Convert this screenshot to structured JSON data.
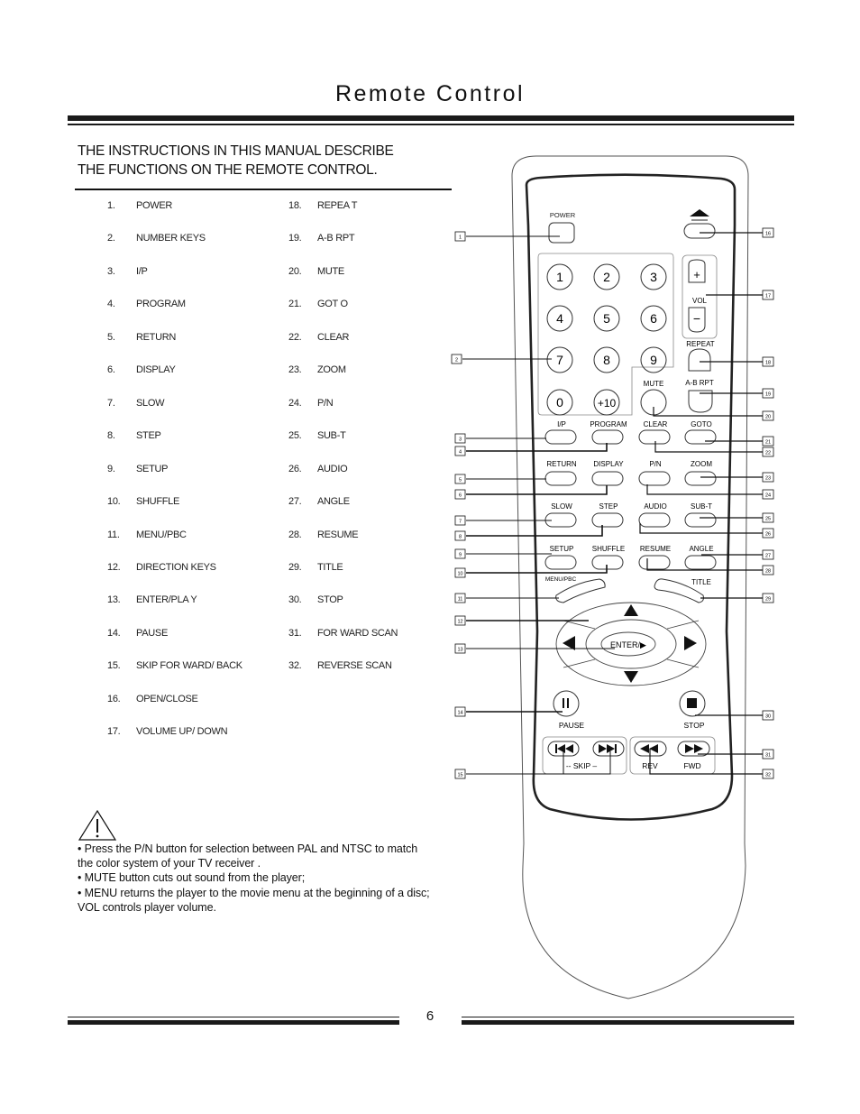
{
  "page": {
    "title": "Remote Control",
    "intro_line1": "THE INSTRUCTIONS IN THIS MANUAL DESCRIBE",
    "intro_line2": "THE FUNCTIONS ON  THE REMOTE CONTROL.",
    "page_number": "6"
  },
  "functions_left": [
    {
      "num": "1.",
      "label": "POWER"
    },
    {
      "num": "2.",
      "label": "NUMBER KEYS"
    },
    {
      "num": "3.",
      "label": "I/P"
    },
    {
      "num": "4.",
      "label": "PROGRAM"
    },
    {
      "num": "5.",
      "label": "RETURN"
    },
    {
      "num": "6.",
      "label": "DISPLAY"
    },
    {
      "num": "7.",
      "label": "SLOW"
    },
    {
      "num": "8.",
      "label": "STEP"
    },
    {
      "num": "9.",
      "label": "SETUP"
    },
    {
      "num": "10.",
      "label": "SHUFFLE"
    },
    {
      "num": "11.",
      "label": "MENU/PBC"
    },
    {
      "num": "12.",
      "label": "DIRECTION KEYS"
    },
    {
      "num": "13.",
      "label": "ENTER/PLA Y"
    },
    {
      "num": "14.",
      "label": "PAUSE"
    },
    {
      "num": "15.",
      "label": "SKIP   FOR WARD/ BACK"
    },
    {
      "num": "16.",
      "label": "OPEN/CLOSE"
    },
    {
      "num": "17.",
      "label": "VOLUME  UP/ DOWN"
    }
  ],
  "functions_right": [
    {
      "num": "18.",
      "label": "REPEA T"
    },
    {
      "num": "19.",
      "label": "A-B RPT"
    },
    {
      "num": "20.",
      "label": "MUTE"
    },
    {
      "num": "21.",
      "label": "GOT O"
    },
    {
      "num": "22.",
      "label": "CLEAR"
    },
    {
      "num": "23.",
      "label": "ZOOM"
    },
    {
      "num": "24.",
      "label": "P/N"
    },
    {
      "num": "25.",
      "label": "SUB-T"
    },
    {
      "num": "26.",
      "label": "AUDIO"
    },
    {
      "num": "27.",
      "label": "ANGLE"
    },
    {
      "num": "28.",
      "label": "RESUME"
    },
    {
      "num": "29.",
      "label": "TITLE"
    },
    {
      "num": "30.",
      "label": "STOP"
    },
    {
      "num": "31.",
      "label": "FOR WARD SCAN"
    },
    {
      "num": "32.",
      "label": "REVERSE SCAN"
    }
  ],
  "notes": {
    "icon": "warning-triangle-icon",
    "lines": [
      "• Press the P/N button for selection between PAL  and NTSC to match",
      "   the color system of your    TV receiver  .",
      "•  MUTE   button cuts out sound from the player;",
      "•  MENU   returns the player to the movie menu at the beginning of a disc;",
      "   VOL   controls player volume."
    ]
  },
  "remote": {
    "labels": {
      "power": "POWER",
      "vol": "VOL",
      "vol_plus": "+",
      "vol_minus": "−",
      "repeat": "REPEAT",
      "ab_rpt": "A-B RPT",
      "mute": "MUTE",
      "ip": "I/P",
      "program": "PROGRAM",
      "clear": "CLEAR",
      "goto": "GOTO",
      "return": "RETURN",
      "display": "DISPLAY",
      "pn": "P/N",
      "zoom": "ZOOM",
      "slow": "SLOW",
      "step": "STEP",
      "audio": "AUDIO",
      "subt": "SUB-T",
      "setup": "SETUP",
      "shuffle": "SHUFFLE",
      "resume": "RESUME",
      "angle": "ANGLE",
      "menupbc": "MENU/PBC",
      "title": "TITLE",
      "enter": "ENTER/▶",
      "pause": "PAUSE",
      "stop": "STOP",
      "skip": "-- SKIP –",
      "rev": "REV",
      "fwd": "FWD"
    },
    "number_keys": [
      "1",
      "2",
      "3",
      "4",
      "5",
      "6",
      "7",
      "8",
      "9",
      "0",
      "+10"
    ],
    "callouts_left": [
      "1",
      "2",
      "3",
      "4",
      "5",
      "6",
      "7",
      "8",
      "9",
      "10",
      "11",
      "12",
      "13",
      "14",
      "15"
    ],
    "callouts_right": [
      "16",
      "17",
      "18",
      "19",
      "20",
      "21",
      "22",
      "23",
      "24",
      "25",
      "26",
      "27",
      "28",
      "29",
      "30",
      "31",
      "32"
    ]
  }
}
